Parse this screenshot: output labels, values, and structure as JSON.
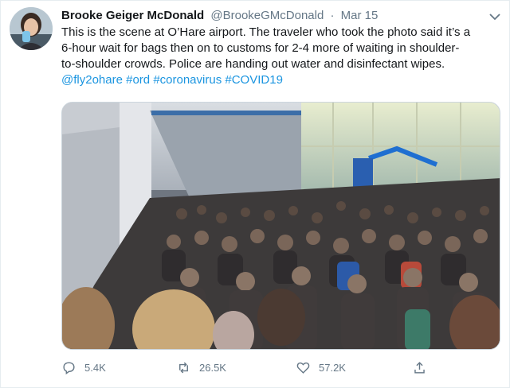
{
  "author": {
    "display_name": "Brooke Geiger McDonald",
    "handle": "@BrookeGMcDonald",
    "separator": "·",
    "date": "Mar 15"
  },
  "tweet": {
    "text": "This is the scene at O’Hare airport. The traveler who took the photo said it’s a\n6-hour wait for bags then on to customs for 2-4 more of waiting in shoulder-\nto-shoulder crowds. Police are handing out water and disinfectant wipes.",
    "hashtags": [
      "@fly2ohare",
      "#ord",
      "#coronavirus",
      "#COVID19"
    ]
  },
  "actions": {
    "reply_count": "5.4K",
    "retweet_count": "26.5K",
    "like_count": "57.2K"
  },
  "icons": [
    "avatar",
    "chevron-down-icon",
    "reply-icon",
    "retweet-icon",
    "like-icon",
    "share-icon"
  ],
  "colors": {
    "link": "#1b95e0",
    "muted": "#657786",
    "text": "#14171a",
    "border": "#e6ecf0"
  }
}
